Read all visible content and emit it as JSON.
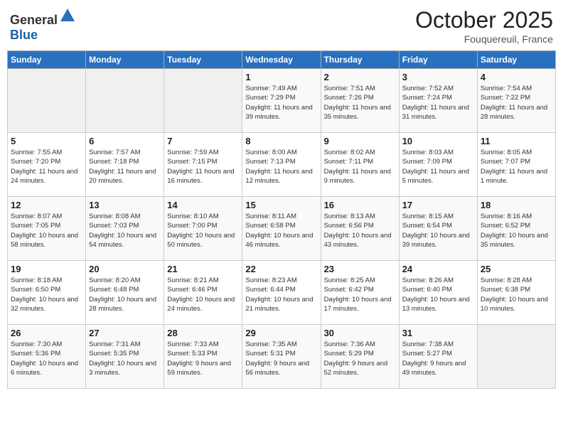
{
  "header": {
    "logo_general": "General",
    "logo_blue": "Blue",
    "month": "October 2025",
    "location": "Fouquereuil, France"
  },
  "weekdays": [
    "Sunday",
    "Monday",
    "Tuesday",
    "Wednesday",
    "Thursday",
    "Friday",
    "Saturday"
  ],
  "weeks": [
    [
      {
        "day": "",
        "info": ""
      },
      {
        "day": "",
        "info": ""
      },
      {
        "day": "",
        "info": ""
      },
      {
        "day": "1",
        "info": "Sunrise: 7:49 AM\nSunset: 7:29 PM\nDaylight: 11 hours\nand 39 minutes."
      },
      {
        "day": "2",
        "info": "Sunrise: 7:51 AM\nSunset: 7:26 PM\nDaylight: 11 hours\nand 35 minutes."
      },
      {
        "day": "3",
        "info": "Sunrise: 7:52 AM\nSunset: 7:24 PM\nDaylight: 11 hours\nand 31 minutes."
      },
      {
        "day": "4",
        "info": "Sunrise: 7:54 AM\nSunset: 7:22 PM\nDaylight: 11 hours\nand 28 minutes."
      }
    ],
    [
      {
        "day": "5",
        "info": "Sunrise: 7:55 AM\nSunset: 7:20 PM\nDaylight: 11 hours\nand 24 minutes."
      },
      {
        "day": "6",
        "info": "Sunrise: 7:57 AM\nSunset: 7:18 PM\nDaylight: 11 hours\nand 20 minutes."
      },
      {
        "day": "7",
        "info": "Sunrise: 7:59 AM\nSunset: 7:15 PM\nDaylight: 11 hours\nand 16 minutes."
      },
      {
        "day": "8",
        "info": "Sunrise: 8:00 AM\nSunset: 7:13 PM\nDaylight: 11 hours\nand 12 minutes."
      },
      {
        "day": "9",
        "info": "Sunrise: 8:02 AM\nSunset: 7:11 PM\nDaylight: 11 hours\nand 9 minutes."
      },
      {
        "day": "10",
        "info": "Sunrise: 8:03 AM\nSunset: 7:09 PM\nDaylight: 11 hours\nand 5 minutes."
      },
      {
        "day": "11",
        "info": "Sunrise: 8:05 AM\nSunset: 7:07 PM\nDaylight: 11 hours\nand 1 minute."
      }
    ],
    [
      {
        "day": "12",
        "info": "Sunrise: 8:07 AM\nSunset: 7:05 PM\nDaylight: 10 hours\nand 58 minutes."
      },
      {
        "day": "13",
        "info": "Sunrise: 8:08 AM\nSunset: 7:03 PM\nDaylight: 10 hours\nand 54 minutes."
      },
      {
        "day": "14",
        "info": "Sunrise: 8:10 AM\nSunset: 7:00 PM\nDaylight: 10 hours\nand 50 minutes."
      },
      {
        "day": "15",
        "info": "Sunrise: 8:11 AM\nSunset: 6:58 PM\nDaylight: 10 hours\nand 46 minutes."
      },
      {
        "day": "16",
        "info": "Sunrise: 8:13 AM\nSunset: 6:56 PM\nDaylight: 10 hours\nand 43 minutes."
      },
      {
        "day": "17",
        "info": "Sunrise: 8:15 AM\nSunset: 6:54 PM\nDaylight: 10 hours\nand 39 minutes."
      },
      {
        "day": "18",
        "info": "Sunrise: 8:16 AM\nSunset: 6:52 PM\nDaylight: 10 hours\nand 35 minutes."
      }
    ],
    [
      {
        "day": "19",
        "info": "Sunrise: 8:18 AM\nSunset: 6:50 PM\nDaylight: 10 hours\nand 32 minutes."
      },
      {
        "day": "20",
        "info": "Sunrise: 8:20 AM\nSunset: 6:48 PM\nDaylight: 10 hours\nand 28 minutes."
      },
      {
        "day": "21",
        "info": "Sunrise: 8:21 AM\nSunset: 6:46 PM\nDaylight: 10 hours\nand 24 minutes."
      },
      {
        "day": "22",
        "info": "Sunrise: 8:23 AM\nSunset: 6:44 PM\nDaylight: 10 hours\nand 21 minutes."
      },
      {
        "day": "23",
        "info": "Sunrise: 8:25 AM\nSunset: 6:42 PM\nDaylight: 10 hours\nand 17 minutes."
      },
      {
        "day": "24",
        "info": "Sunrise: 8:26 AM\nSunset: 6:40 PM\nDaylight: 10 hours\nand 13 minutes."
      },
      {
        "day": "25",
        "info": "Sunrise: 8:28 AM\nSunset: 6:38 PM\nDaylight: 10 hours\nand 10 minutes."
      }
    ],
    [
      {
        "day": "26",
        "info": "Sunrise: 7:30 AM\nSunset: 5:36 PM\nDaylight: 10 hours\nand 6 minutes."
      },
      {
        "day": "27",
        "info": "Sunrise: 7:31 AM\nSunset: 5:35 PM\nDaylight: 10 hours\nand 3 minutes."
      },
      {
        "day": "28",
        "info": "Sunrise: 7:33 AM\nSunset: 5:33 PM\nDaylight: 9 hours\nand 59 minutes."
      },
      {
        "day": "29",
        "info": "Sunrise: 7:35 AM\nSunset: 5:31 PM\nDaylight: 9 hours\nand 56 minutes."
      },
      {
        "day": "30",
        "info": "Sunrise: 7:36 AM\nSunset: 5:29 PM\nDaylight: 9 hours\nand 52 minutes."
      },
      {
        "day": "31",
        "info": "Sunrise: 7:38 AM\nSunset: 5:27 PM\nDaylight: 9 hours\nand 49 minutes."
      },
      {
        "day": "",
        "info": ""
      }
    ]
  ]
}
